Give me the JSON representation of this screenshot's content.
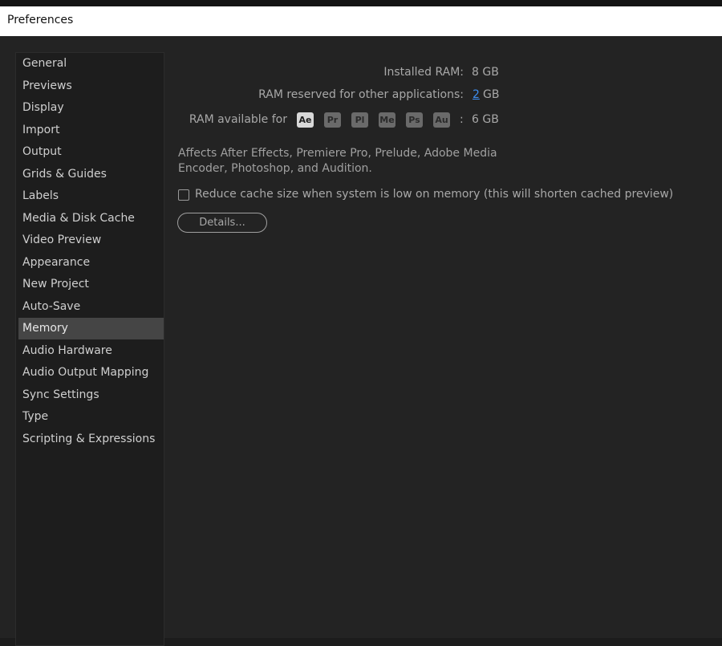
{
  "window": {
    "title": "Preferences"
  },
  "sidebar": {
    "selected_index": 12,
    "items": [
      {
        "label": "General"
      },
      {
        "label": "Previews"
      },
      {
        "label": "Display"
      },
      {
        "label": "Import"
      },
      {
        "label": "Output"
      },
      {
        "label": "Grids & Guides"
      },
      {
        "label": "Labels"
      },
      {
        "label": "Media & Disk Cache"
      },
      {
        "label": "Video Preview"
      },
      {
        "label": "Appearance"
      },
      {
        "label": "New Project"
      },
      {
        "label": "Auto-Save"
      },
      {
        "label": "Memory"
      },
      {
        "label": "Audio Hardware"
      },
      {
        "label": "Audio Output Mapping"
      },
      {
        "label": "Sync Settings"
      },
      {
        "label": "Type"
      },
      {
        "label": "Scripting & Expressions"
      }
    ]
  },
  "memory": {
    "installed_ram_label": "Installed RAM:",
    "installed_ram_value": "8 GB",
    "reserved_label": "RAM reserved for other applications:",
    "reserved_value": "2",
    "reserved_unit": "GB",
    "available_label": "RAM available for",
    "apps": [
      "Ae",
      "Pr",
      "Pl",
      "Me",
      "Ps",
      "Au"
    ],
    "active_app": "Ae",
    "available_sep": ":",
    "available_value": "6 GB",
    "description": "Affects After Effects, Premiere Pro, Prelude, Adobe Media Encoder, Photoshop, and Audition.",
    "reduce_cache_label": "Reduce cache size when system is low on memory (this will shorten cached preview)",
    "reduce_cache_checked": false,
    "details_button": "Details..."
  }
}
